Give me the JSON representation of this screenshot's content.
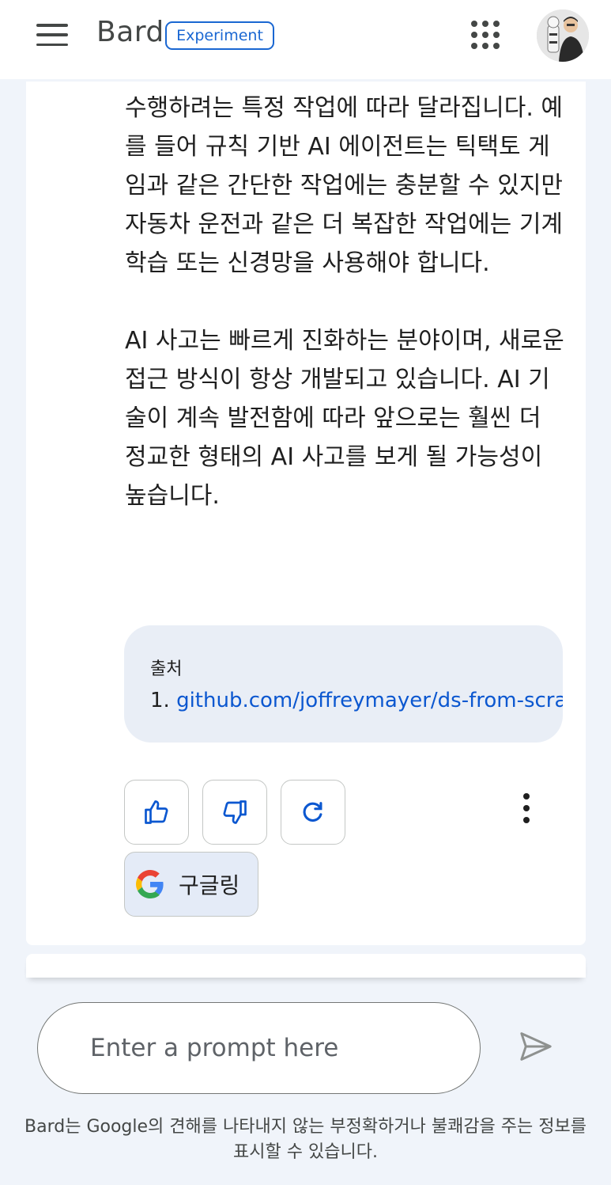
{
  "header": {
    "brand": "Bard",
    "badge": "Experiment",
    "menu_icon": "hamburger-menu-icon",
    "apps_icon": "apps-grid-icon",
    "avatar_icon": "user-avatar"
  },
  "response": {
    "paragraphs": [
      "수행하려는 특정 작업에 따라 달라집니다. 예를 들어 규칙 기반 AI 에이전트는 틱택토 게임과 같은 간단한 작업에는 충분할 수 있지만 자동차 운전과 같은 더 복잡한 작업에는 기계 학습 또는 신경망을 사용해야 합니다.",
      "AI 사고는 빠르게 진화하는 분야이며, 새로운 접근 방식이 항상 개발되고 있습니다. AI 기술이 계속 발전함에 따라 앞으로는 훨씬 더 정교한 형태의 AI 사고를 보게 될 가능성이 높습니다."
    ]
  },
  "sources": {
    "title": "출처",
    "items": [
      {
        "num": "1.",
        "url": "github.com/joffreymayer/ds-from-scra"
      }
    ]
  },
  "actions": {
    "thumbs_up_icon": "thumbs-up-icon",
    "thumbs_down_icon": "thumbs-down-icon",
    "regenerate_icon": "refresh-icon",
    "more_icon": "more-vert-icon",
    "google_label": "구글링"
  },
  "prompt": {
    "placeholder": "Enter a prompt here",
    "value": "",
    "send_icon": "send-icon"
  },
  "disclaimer": "Bard는 Google의 견해를 나타내지 않는 부정확하거나 불쾌감을 주는 정보를 표시할 수 있습니다.",
  "colors": {
    "background": "#f0f4fa",
    "accent": "#0b57d0",
    "badge": "#1a67d2",
    "sources_bg": "#e9eef6",
    "google_btn_bg": "#e4ebf7"
  }
}
